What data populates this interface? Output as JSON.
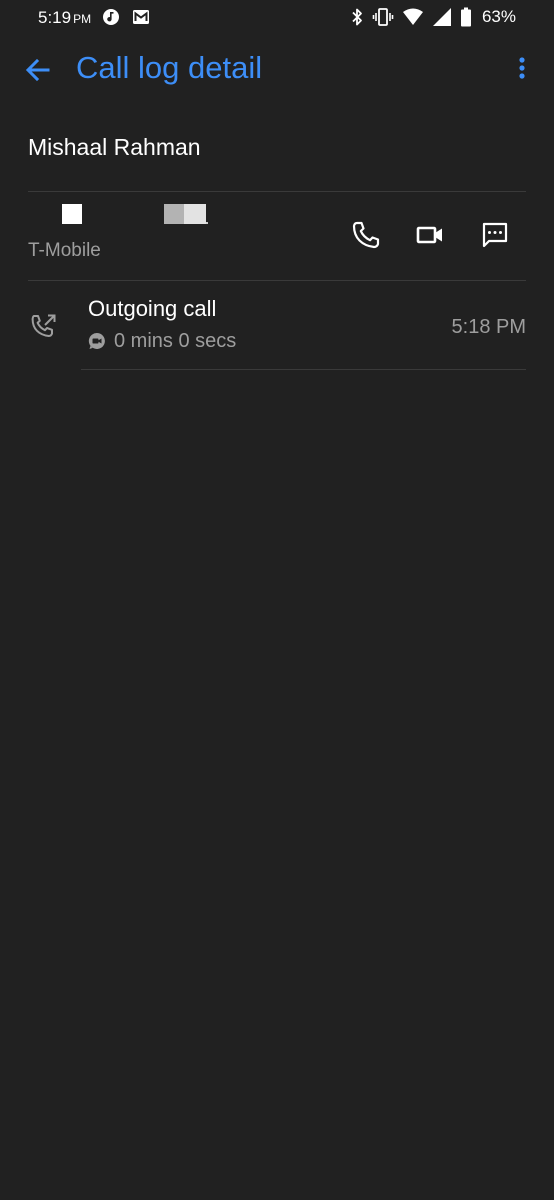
{
  "status_bar": {
    "time": "5:19",
    "ampm": "PM",
    "battery_percent": "63%",
    "icons_left": [
      "music-note-icon",
      "gmail-icon"
    ],
    "icons_right": [
      "bluetooth-icon",
      "vibrate-icon",
      "wifi-icon",
      "cell-signal-icon",
      "battery-icon"
    ]
  },
  "app_bar": {
    "title": "Call log detail",
    "back_icon": "arrow-back-icon",
    "overflow_icon": "more-vert-icon"
  },
  "contact": {
    "name": "Mishaal Rahman",
    "carrier": "T-Mobile"
  },
  "actions": [
    {
      "name": "voice-call",
      "icon": "phone-icon"
    },
    {
      "name": "video-call",
      "icon": "videocam-icon"
    },
    {
      "name": "message",
      "icon": "message-icon"
    }
  ],
  "call_entries": [
    {
      "type": "Outgoing call",
      "type_icon": "outgoing-call-icon",
      "duration_icon": "duo-icon",
      "duration": "0 mins 0 secs",
      "time": "5:18 PM"
    }
  ],
  "colors": {
    "background": "#212121",
    "accent": "#3d8ef7",
    "primary_text": "#ffffff",
    "secondary_text": "#9e9e9e",
    "divider": "#3a3a3a"
  }
}
